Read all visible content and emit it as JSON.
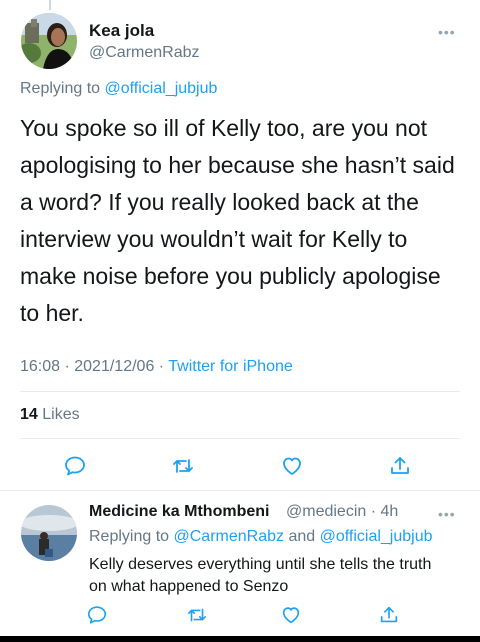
{
  "main": {
    "display_name": "Kea jola",
    "handle": "@CarmenRabz",
    "replying_prefix": "Replying to",
    "replying_to": "@official_jubjub",
    "text": "You spoke so ill of Kelly too, are you not apologising to her because she hasn’t said a word? If you really looked back at the interview you wouldn’t wait for Kelly to make noise before you publicly apologise to her.",
    "timestamp": "16:08 · 2021/12/06 · ",
    "source": "Twitter for iPhone",
    "likes_count": "14",
    "likes_label": " Likes"
  },
  "reply": {
    "display_name": "Medicine ka Mthombeni",
    "handle_time": "@mediecin · 4h",
    "replying_prefix": "Replying to",
    "replying_to_1": "@CarmenRabz",
    "replying_and": " and ",
    "replying_to_2": "@official_jubjub",
    "text": "Kelly deserves everything until she tells the truth on what happened to Senzo"
  },
  "icons": {
    "more": "more-horizontal-icon",
    "reply": "comment-icon",
    "retweet": "retweet-icon",
    "like": "heart-icon",
    "share": "share-icon"
  },
  "colors": {
    "accent": "#1da1f2",
    "secondary_text": "#657786",
    "primary_text": "#14171a"
  }
}
